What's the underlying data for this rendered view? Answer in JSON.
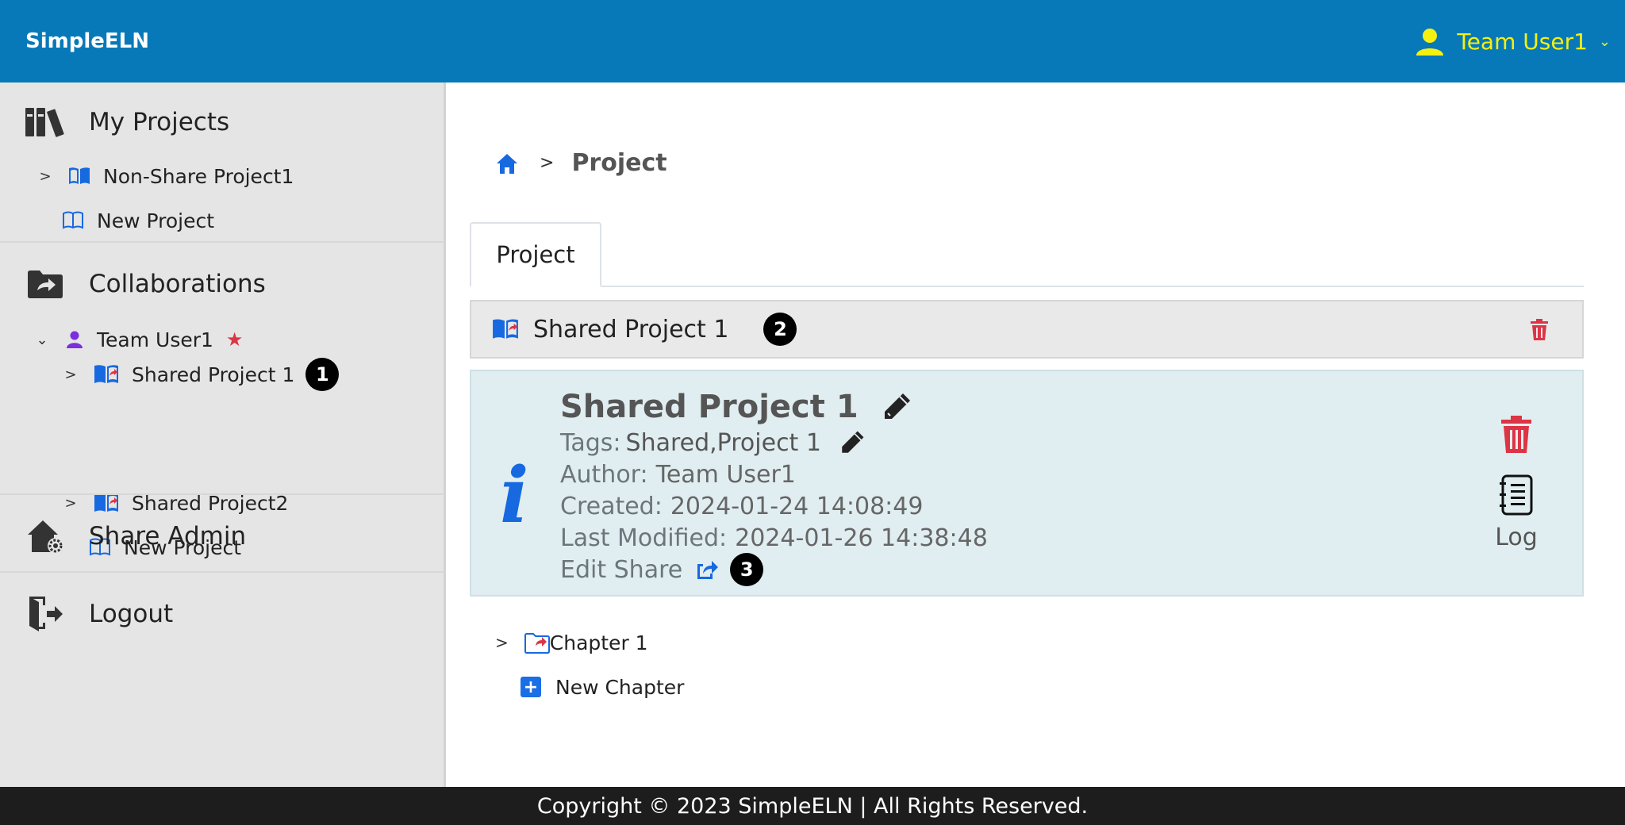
{
  "header": {
    "brand": "SimpleELN",
    "user_label": "Team User1",
    "user_icon": "user-icon",
    "chevron": "⌄",
    "accent_color": "#0779b9",
    "user_color": "#f5f010"
  },
  "sidebar": {
    "my_projects": {
      "label": "My Projects",
      "icon": "library-books-icon",
      "items": [
        {
          "arrow": ">",
          "label": "Non-Share Project1"
        },
        {
          "label": "New Project"
        }
      ]
    },
    "collaborations": {
      "label": "Collaborations",
      "icon": "shared-folder-icon",
      "user": {
        "arrow": "⌄",
        "label": "Team User1",
        "star": "★"
      },
      "items": [
        {
          "arrow": ">",
          "label": "Shared Project 1",
          "badge": "1"
        },
        {
          "arrow": ">",
          "label": "Shared Project2"
        },
        {
          "label": "New Project"
        }
      ]
    },
    "share_admin": {
      "label": "Share Admin",
      "icon": "house-gear-icon"
    },
    "logout": {
      "label": "Logout",
      "icon": "logout-door-icon"
    }
  },
  "breadcrumb": {
    "home_icon": "home-icon",
    "separator": ">",
    "current": "Project"
  },
  "tabs": [
    {
      "label": "Project"
    }
  ],
  "project_header": {
    "title": "Shared Project 1",
    "badge": "2"
  },
  "project_info": {
    "icon_glyph": "i",
    "title": "Shared Project 1",
    "tags_label": "Tags:",
    "tags_value": "Shared,Project 1",
    "author_label": "Author:",
    "author_value": "Team User1",
    "created_label": "Created:",
    "created_value": "2024-01-24 14:08:49",
    "modified_label": "Last Modified:",
    "modified_value": "2024-01-26 14:38:48",
    "edit_share_label": "Edit Share",
    "badge": "3",
    "log_label": "Log"
  },
  "chapters": {
    "items": [
      {
        "arrow": ">",
        "label": "Chapter 1"
      }
    ],
    "new_label": "New Chapter",
    "plus": "+"
  },
  "footer": {
    "text": "Copyright © 2023 SimpleELN | All Rights Reserved."
  }
}
